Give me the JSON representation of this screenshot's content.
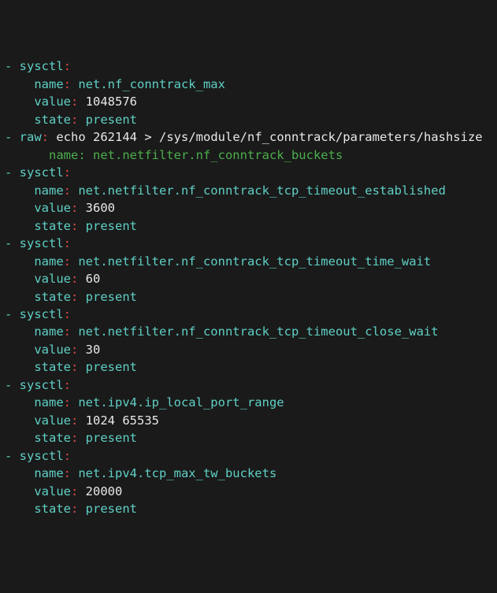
{
  "lines": [
    [
      [
        "dash",
        "- "
      ],
      [
        "key",
        "sysctl"
      ],
      [
        "colon",
        ":"
      ]
    ],
    [
      [
        "dash",
        "    "
      ],
      [
        "key",
        "name"
      ],
      [
        "colon",
        ": "
      ],
      [
        "str",
        "net.nf_conntrack_max"
      ]
    ],
    [
      [
        "dash",
        "    "
      ],
      [
        "key",
        "value"
      ],
      [
        "colon",
        ": "
      ],
      [
        "num",
        "1048576"
      ]
    ],
    [
      [
        "dash",
        "    "
      ],
      [
        "key",
        "state"
      ],
      [
        "colon",
        ": "
      ],
      [
        "str",
        "present"
      ]
    ],
    [
      [
        "dash",
        "- "
      ],
      [
        "key",
        "raw"
      ],
      [
        "colon",
        ": "
      ],
      [
        "strw",
        "echo "
      ],
      [
        "num",
        "262144"
      ],
      [
        "strw",
        " > /sys/module/nf_conntrack/parameters/hashsize"
      ]
    ],
    [
      [
        "dash",
        "      "
      ],
      [
        "cmt",
        "name: net.netfilter.nf_conntrack_buckets"
      ]
    ],
    [
      [
        "dash",
        "- "
      ],
      [
        "key",
        "sysctl"
      ],
      [
        "colon",
        ":"
      ]
    ],
    [
      [
        "dash",
        "    "
      ],
      [
        "key",
        "name"
      ],
      [
        "colon",
        ": "
      ],
      [
        "str",
        "net.netfilter.nf_conntrack_tcp_timeout_established"
      ]
    ],
    [
      [
        "dash",
        "    "
      ],
      [
        "key",
        "value"
      ],
      [
        "colon",
        ": "
      ],
      [
        "num",
        "3600"
      ]
    ],
    [
      [
        "dash",
        "    "
      ],
      [
        "key",
        "state"
      ],
      [
        "colon",
        ": "
      ],
      [
        "str",
        "present"
      ]
    ],
    [
      [
        "dash",
        "- "
      ],
      [
        "key",
        "sysctl"
      ],
      [
        "colon",
        ":"
      ]
    ],
    [
      [
        "dash",
        "    "
      ],
      [
        "key",
        "name"
      ],
      [
        "colon",
        ": "
      ],
      [
        "str",
        "net.netfilter.nf_conntrack_tcp_timeout_time_wait"
      ]
    ],
    [
      [
        "dash",
        "    "
      ],
      [
        "key",
        "value"
      ],
      [
        "colon",
        ": "
      ],
      [
        "num",
        "60"
      ]
    ],
    [
      [
        "dash",
        "    "
      ],
      [
        "key",
        "state"
      ],
      [
        "colon",
        ": "
      ],
      [
        "str",
        "present"
      ]
    ],
    [
      [
        "dash",
        "- "
      ],
      [
        "key",
        "sysctl"
      ],
      [
        "colon",
        ":"
      ]
    ],
    [
      [
        "dash",
        "    "
      ],
      [
        "key",
        "name"
      ],
      [
        "colon",
        ": "
      ],
      [
        "str",
        "net.netfilter.nf_conntrack_tcp_timeout_close_wait"
      ]
    ],
    [
      [
        "dash",
        "    "
      ],
      [
        "key",
        "value"
      ],
      [
        "colon",
        ": "
      ],
      [
        "num",
        "30"
      ]
    ],
    [
      [
        "dash",
        "    "
      ],
      [
        "key",
        "state"
      ],
      [
        "colon",
        ": "
      ],
      [
        "str",
        "present"
      ]
    ],
    [
      [
        "dash",
        "- "
      ],
      [
        "key",
        "sysctl"
      ],
      [
        "colon",
        ":"
      ]
    ],
    [
      [
        "dash",
        "    "
      ],
      [
        "key",
        "name"
      ],
      [
        "colon",
        ": "
      ],
      [
        "str",
        "net.ipv4.ip_local_port_range"
      ]
    ],
    [
      [
        "dash",
        "    "
      ],
      [
        "key",
        "value"
      ],
      [
        "colon",
        ": "
      ],
      [
        "num",
        "1024 65535"
      ]
    ],
    [
      [
        "dash",
        "    "
      ],
      [
        "key",
        "state"
      ],
      [
        "colon",
        ": "
      ],
      [
        "str",
        "present"
      ]
    ],
    [
      [
        "dash",
        "- "
      ],
      [
        "key",
        "sysctl"
      ],
      [
        "colon",
        ":"
      ]
    ],
    [
      [
        "dash",
        "    "
      ],
      [
        "key",
        "name"
      ],
      [
        "colon",
        ": "
      ],
      [
        "str",
        "net.ipv4.tcp_max_tw_buckets"
      ]
    ],
    [
      [
        "dash",
        "    "
      ],
      [
        "key",
        "value"
      ],
      [
        "colon",
        ": "
      ],
      [
        "num",
        "20000"
      ]
    ],
    [
      [
        "dash",
        "    "
      ],
      [
        "key",
        "state"
      ],
      [
        "colon",
        ": "
      ],
      [
        "str",
        "present"
      ]
    ]
  ]
}
